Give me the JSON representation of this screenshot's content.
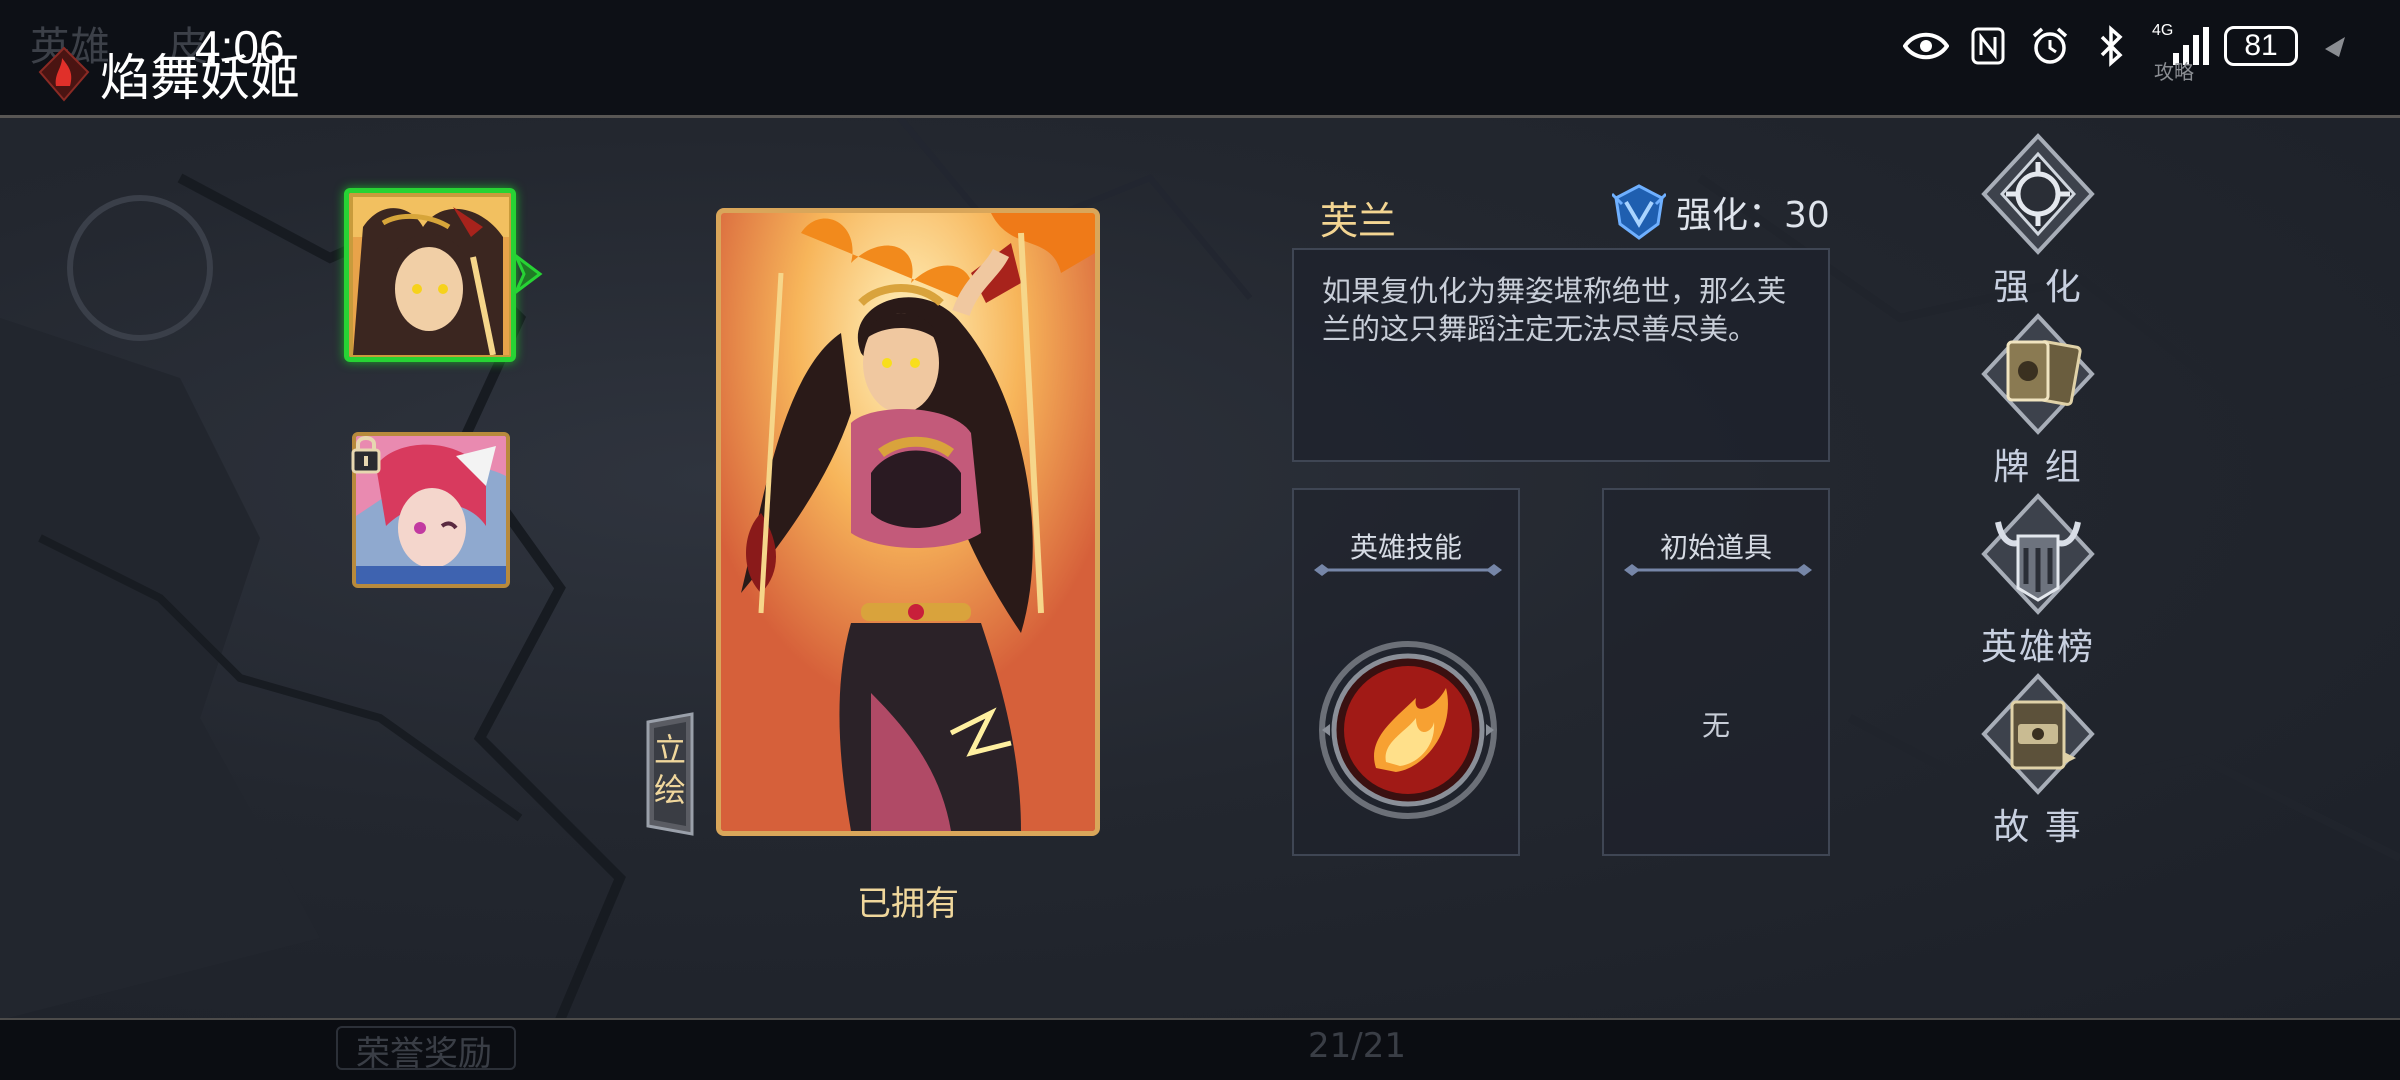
{
  "top_bar": {
    "ghost_tab_1": "英雄",
    "ghost_tab_2": "皮",
    "clock": "4:06",
    "title": "焰舞妖姬",
    "network_label": "4G",
    "guide_hint": "攻略",
    "battery": "81"
  },
  "heroes": {
    "selected": "fire-dancer-portrait",
    "other": "locked-hero-portrait"
  },
  "portrait": {
    "side_tab": "立绘",
    "ownership": "已拥有"
  },
  "info": {
    "hero_name": "芙兰",
    "enhance_label": "强化：30",
    "description": "如果复仇化为舞姿堪称绝世，那么芙兰的这只舞蹈注定无法尽善尽美。",
    "skill_header": "英雄技能",
    "item_header": "初始道具",
    "item_value": "无"
  },
  "menu": [
    {
      "label": "强 化",
      "icon": "enhance-icon"
    },
    {
      "label": "牌 组",
      "icon": "deck-icon"
    },
    {
      "label": "英雄榜",
      "icon": "hero-ranking-icon"
    },
    {
      "label": "故 事",
      "icon": "story-icon"
    }
  ],
  "footer": {
    "honor_reward": "荣誉奖励",
    "page_counter": "21/21"
  },
  "colors": {
    "gold_text": "#f3d592",
    "selection_green": "#27d334",
    "panel_border": "#3f4654"
  }
}
